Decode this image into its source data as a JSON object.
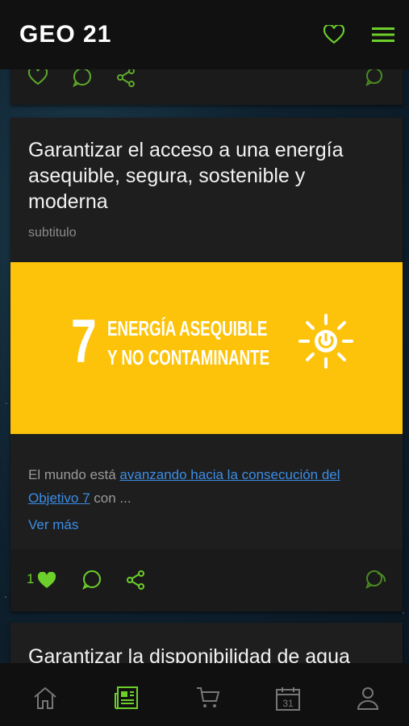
{
  "app": {
    "logo": "GEO 21"
  },
  "article": {
    "title": "Garantizar el acceso a una energía asequible, segura, sostenible y moderna",
    "subtitle": "subtitulo",
    "hero": {
      "number": "7",
      "line1": "ENERGÍA ASEQUIBLE",
      "line2": "Y NO CONTAMINANTE",
      "color": "#fdc30a"
    },
    "excerpt_prefix": "El mundo está ",
    "excerpt_link": "avanzando hacia la consecución del Objetivo 7",
    "excerpt_suffix": " con ...",
    "read_more": "Ver más",
    "likes": "1"
  },
  "next_article": {
    "title": "Garantizar la disponibilidad de agua"
  },
  "colors": {
    "accent": "#6ccf2a",
    "link": "#3b8ee6"
  },
  "icons": [
    "heart-icon",
    "menu-icon",
    "comment-icon",
    "share-icon",
    "chat-icon",
    "home-icon",
    "news-icon",
    "cart-icon",
    "calendar-icon",
    "profile-icon"
  ],
  "bottom_nav": {
    "calendar_day": "31"
  }
}
